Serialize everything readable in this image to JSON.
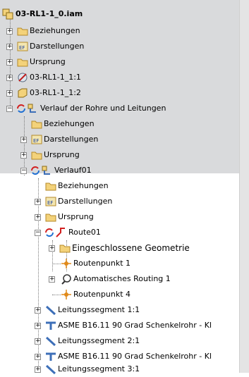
{
  "tree": {
    "root": "03-RL1-1_0.iam",
    "items": [
      {
        "label": "Beziehungen"
      },
      {
        "label": "Darstellungen"
      },
      {
        "label": "Ursprung"
      },
      {
        "label": "03-RL1-1_1:1"
      },
      {
        "label": "03-RL1-1_1:2"
      },
      {
        "label": "Verlauf der Rohre und Leitungen"
      },
      {
        "label": "Beziehungen"
      },
      {
        "label": "Darstellungen"
      },
      {
        "label": "Ursprung"
      },
      {
        "label": "Verlauf01"
      },
      {
        "label": "Beziehungen"
      },
      {
        "label": "Darstellungen"
      },
      {
        "label": "Ursprung"
      },
      {
        "label": "Route01"
      },
      {
        "label": "Eingeschlossene Geometrie"
      },
      {
        "label": "Routenpunkt 1"
      },
      {
        "label": "Automatisches Routing 1"
      },
      {
        "label": "Routenpunkt 4"
      },
      {
        "label": "Leitungssegment 1:1"
      },
      {
        "label": "ASME B16.11 90 Grad Schenkelrohr - Kl"
      },
      {
        "label": "Leitungssegment 2:1"
      },
      {
        "label": "ASME B16.11 90 Grad Schenkelrohr - Kl"
      },
      {
        "label": "Leitungssegment 3:1"
      }
    ]
  },
  "colors": {
    "folder": "#f3d27a",
    "selection": "#d9dadc",
    "route": "#d21f1f",
    "point": "#e08a1a",
    "segment": "#3d6fb8"
  }
}
